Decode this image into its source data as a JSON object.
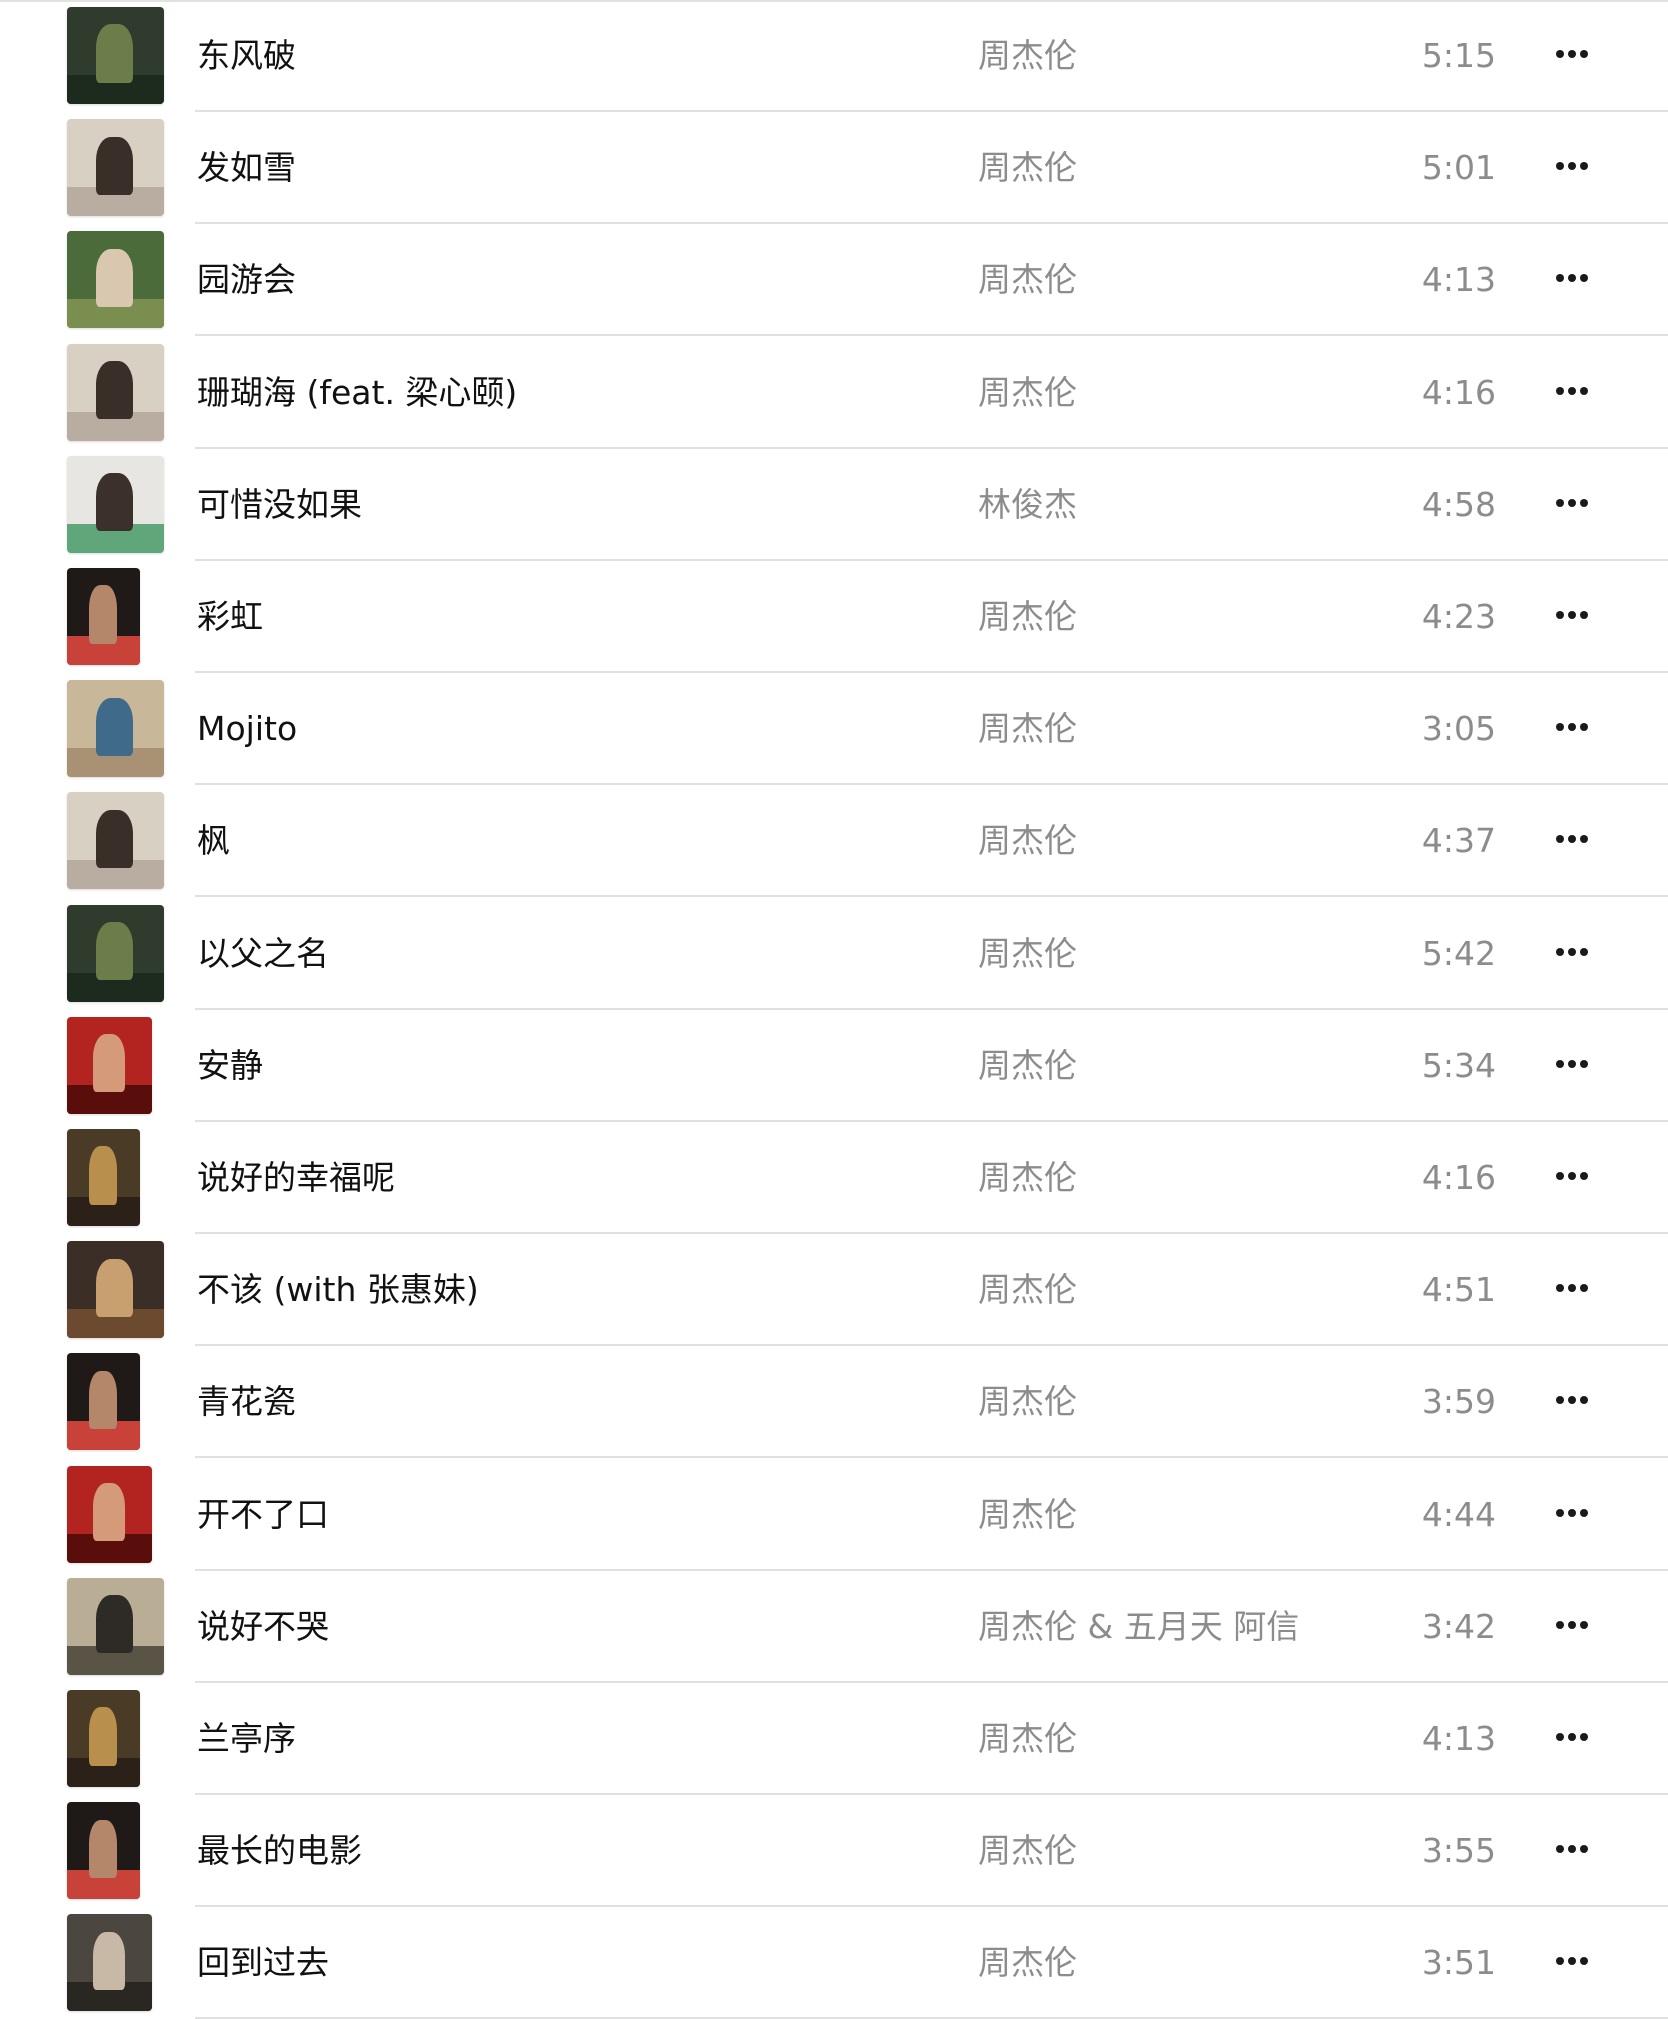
{
  "songs": [
    {
      "title": "东风破",
      "artist": "周杰伦",
      "duration": "5:15",
      "art": {
        "icon": "album-art-icon",
        "c1": "#2f3b2c",
        "c2": "#6b7e4a",
        "c3": "#1d2a1e",
        "shape": "square"
      }
    },
    {
      "title": "发如雪",
      "artist": "周杰伦",
      "duration": "5:01",
      "art": {
        "icon": "album-art-icon",
        "c1": "#d8d0c2",
        "c2": "#3a2f28",
        "c3": "#b8ada0",
        "shape": "square"
      }
    },
    {
      "title": "园游会",
      "artist": "周杰伦",
      "duration": "4:13",
      "art": {
        "icon": "album-art-icon",
        "c1": "#4b6b3a",
        "c2": "#d9c7b0",
        "c3": "#7a8f4f",
        "shape": "square"
      }
    },
    {
      "title": "珊瑚海 (feat. 梁心颐)",
      "artist": "周杰伦",
      "duration": "4:16",
      "art": {
        "icon": "album-art-icon",
        "c1": "#d8d0c2",
        "c2": "#3a2f28",
        "c3": "#b8ada0",
        "shape": "square"
      }
    },
    {
      "title": "可惜没如果",
      "artist": "林俊杰",
      "duration": "4:58",
      "art": {
        "icon": "album-art-icon",
        "c1": "#e8e6e2",
        "c2": "#3b302a",
        "c3": "#5fa77a",
        "shape": "square"
      }
    },
    {
      "title": "彩虹",
      "artist": "周杰伦",
      "duration": "4:23",
      "art": {
        "icon": "album-art-icon",
        "c1": "#1f1a17",
        "c2": "#b4876a",
        "c3": "#c9423a",
        "shape": "narrow"
      }
    },
    {
      "title": "Mojito",
      "artist": "周杰伦",
      "duration": "3:05",
      "art": {
        "icon": "album-art-icon",
        "c1": "#c9b79a",
        "c2": "#3f6a8a",
        "c3": "#a99273",
        "shape": "square"
      }
    },
    {
      "title": "枫",
      "artist": "周杰伦",
      "duration": "4:37",
      "art": {
        "icon": "album-art-icon",
        "c1": "#d8d0c2",
        "c2": "#3a2f28",
        "c3": "#b8ada0",
        "shape": "square"
      }
    },
    {
      "title": "以父之名",
      "artist": "周杰伦",
      "duration": "5:42",
      "art": {
        "icon": "album-art-icon",
        "c1": "#2f3b2c",
        "c2": "#6b7e4a",
        "c3": "#1d2a1e",
        "shape": "square"
      }
    },
    {
      "title": "安静",
      "artist": "周杰伦",
      "duration": "5:34",
      "art": {
        "icon": "album-art-icon",
        "c1": "#b3231f",
        "c2": "#d59a7a",
        "c3": "#5a0e0c",
        "shape": "mid"
      }
    },
    {
      "title": "说好的幸福呢",
      "artist": "周杰伦",
      "duration": "4:16",
      "art": {
        "icon": "album-art-icon",
        "c1": "#4a3b26",
        "c2": "#b98f4e",
        "c3": "#2b2118",
        "shape": "narrow"
      }
    },
    {
      "title": "不该 (with 张惠妹)",
      "artist": "周杰伦",
      "duration": "4:51",
      "art": {
        "icon": "album-art-icon",
        "c1": "#3b2e26",
        "c2": "#c8a070",
        "c3": "#6b4a30",
        "shape": "square"
      }
    },
    {
      "title": "青花瓷",
      "artist": "周杰伦",
      "duration": "3:59",
      "art": {
        "icon": "album-art-icon",
        "c1": "#1f1a17",
        "c2": "#b4876a",
        "c3": "#c9423a",
        "shape": "narrow"
      }
    },
    {
      "title": "开不了口",
      "artist": "周杰伦",
      "duration": "4:44",
      "art": {
        "icon": "album-art-icon",
        "c1": "#b3231f",
        "c2": "#d59a7a",
        "c3": "#5a0e0c",
        "shape": "mid"
      }
    },
    {
      "title": "说好不哭",
      "artist": "周杰伦 & 五月天 阿信",
      "duration": "3:42",
      "art": {
        "icon": "album-art-icon",
        "c1": "#b9ae95",
        "c2": "#2e2b27",
        "c3": "#5a5446",
        "shape": "square"
      }
    },
    {
      "title": "兰亭序",
      "artist": "周杰伦",
      "duration": "4:13",
      "art": {
        "icon": "album-art-icon",
        "c1": "#4a3b26",
        "c2": "#b98f4e",
        "c3": "#2b2118",
        "shape": "narrow"
      }
    },
    {
      "title": "最长的电影",
      "artist": "周杰伦",
      "duration": "3:55",
      "art": {
        "icon": "album-art-icon",
        "c1": "#1f1a17",
        "c2": "#b4876a",
        "c3": "#c9423a",
        "shape": "narrow"
      }
    },
    {
      "title": "回到过去",
      "artist": "周杰伦",
      "duration": "3:51",
      "art": {
        "icon": "album-art-icon",
        "c1": "#4b4740",
        "c2": "#c7b9a6",
        "c3": "#2a2622",
        "shape": "mid"
      }
    }
  ],
  "more_icon": "more-ellipsis-icon"
}
